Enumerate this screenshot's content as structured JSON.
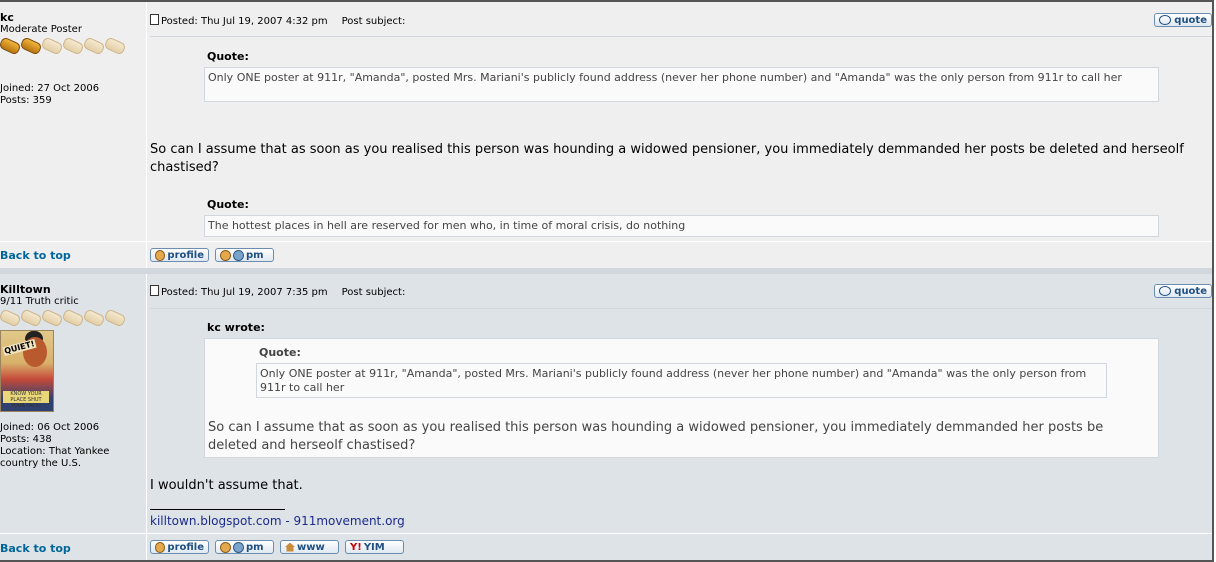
{
  "posts": [
    {
      "author": "kc",
      "rank": "Moderate Poster",
      "stars_filled": 2,
      "stars_total": 6,
      "joined": "Joined: 27 Oct 2006",
      "posts": "Posts: 359",
      "posted": "Posted: Thu Jul 19, 2007 4:32 pm",
      "subject": "Post subject:",
      "quote_label": "Quote:",
      "quote_text": "Only ONE poster at 911r, \"Amanda\", posted Mrs. Mariani's publicly found address (never her phone number) and \"Amanda\" was the only person from 911r to call her",
      "body": "So can I assume that as soon as you realised this person was hounding a widowed pensioner, you immediately demmanded her posts be deleted and herseolf chastised?",
      "quote2_label": "Quote:",
      "quote2_text": "The hottest places in hell are reserved for men who, in time of moral crisis, do nothing",
      "back_to_top": "Back to top",
      "buttons": {
        "quote": "quote",
        "profile": "profile",
        "pm": "pm"
      }
    },
    {
      "author": "Killtown",
      "rank": "9/11 Truth critic",
      "stars_filled": 0,
      "stars_total": 6,
      "avatar_text": "QUIET!",
      "avatar_band": "KNOW YOUR PLACE SHUT YOUR FACE!",
      "joined": "Joined: 06 Oct 2006",
      "posts": "Posts: 438",
      "location": "Location: That Yankee country the U.S.",
      "posted": "Posted: Thu Jul 19, 2007 7:35 pm",
      "subject": "Post subject:",
      "outer_quote_label": "kc wrote:",
      "inner_quote_label": "Quote:",
      "inner_quote_text": "Only ONE poster at 911r, \"Amanda\", posted Mrs. Mariani's publicly found address (never her phone number) and \"Amanda\" was the only person from 911r to call her",
      "outer_quote_text": "So can I assume that as soon as you realised this person was hounding a widowed pensioner, you immediately demmanded her posts be deleted and herseolf chastised?",
      "body": "I wouldn't assume that.",
      "signature": "killtown.blogspot.com - 911movement.org",
      "back_to_top": "Back to top",
      "buttons": {
        "quote": "quote",
        "profile": "profile",
        "pm": "pm",
        "www": "www",
        "yim": "YIM"
      }
    }
  ]
}
